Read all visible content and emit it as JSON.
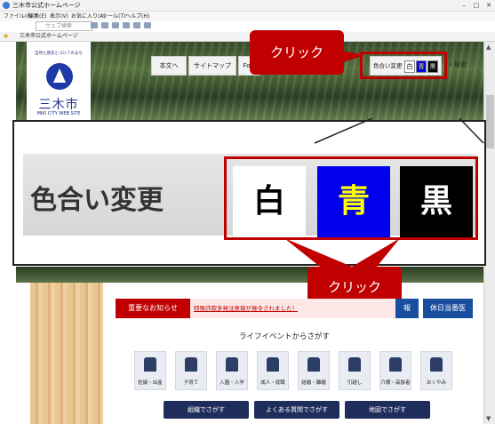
{
  "browser": {
    "title": "三木市公式ホームページ",
    "menu": [
      "ファイル(F)",
      "編集(E)",
      "表示(V)",
      "お気に入り(A)",
      "ツール(T)",
      "ヘルプ(H)"
    ],
    "search_placeholder": "ウェブ検索",
    "favorites_link": "三木市公式ホームページ",
    "window_controls": [
      "–",
      "□",
      "✕"
    ]
  },
  "site": {
    "logo_tagline": "自然と歴史とゴルフのまち",
    "logo_name": "三木市",
    "logo_sub": "MIKI CITY WEB SITE",
    "nav": {
      "main_text": "本文へ",
      "sitemap": "サイトマップ",
      "foreign": "Fore"
    },
    "color_change": {
      "label": "色合い変更",
      "white": "白",
      "blue": "青",
      "black": "黒"
    },
    "search": "検索",
    "notice": {
      "label": "重要なお知らせ",
      "message": "特殊詐欺多発注意報が発令されました！"
    },
    "kyujitsu": "休日当番医",
    "hidden_btn": "報",
    "life_title": "ライフイベントからさがす",
    "life_events": [
      "妊娠・出産",
      "子育て",
      "入園・入学",
      "成人・就職",
      "結婚・離婚",
      "引越し",
      "介護・高齢者",
      "おくやみ"
    ],
    "bottom_buttons": [
      "組織でさがす",
      "よくある質問でさがす",
      "地図でさがす"
    ]
  },
  "annotations": {
    "click_top": "クリック",
    "click_bottom": "クリック"
  },
  "colors": {
    "accent_red": "#c00000",
    "blue_swatch": "#0000ee",
    "black_swatch": "#000000",
    "navy": "#1e2d5c"
  }
}
